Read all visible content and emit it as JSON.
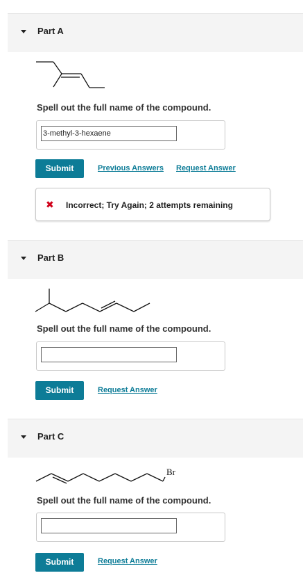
{
  "colors": {
    "accent": "#0d7c97",
    "error": "#d0021b",
    "header_bg": "#f4f4f4"
  },
  "parts": [
    {
      "title": "Part A",
      "structure_label": "",
      "prompt": "Spell out the full name of the compound.",
      "answer_value": "3-methyl-3-hexaene",
      "answer_placeholder": "",
      "submit_label": "Submit",
      "previous_answers_label": "Previous Answers",
      "request_answer_label": "Request Answer",
      "feedback": {
        "icon": "x-icon",
        "text": "Incorrect; Try Again; 2 attempts remaining"
      }
    },
    {
      "title": "Part B",
      "structure_label": "",
      "prompt": "Spell out the full name of the compound.",
      "answer_value": "",
      "answer_placeholder": "",
      "submit_label": "Submit",
      "request_answer_label": "Request Answer"
    },
    {
      "title": "Part C",
      "structure_label": "Br",
      "prompt": "Spell out the full name of the compound.",
      "answer_value": "",
      "answer_placeholder": "",
      "submit_label": "Submit",
      "request_answer_label": "Request Answer"
    }
  ]
}
